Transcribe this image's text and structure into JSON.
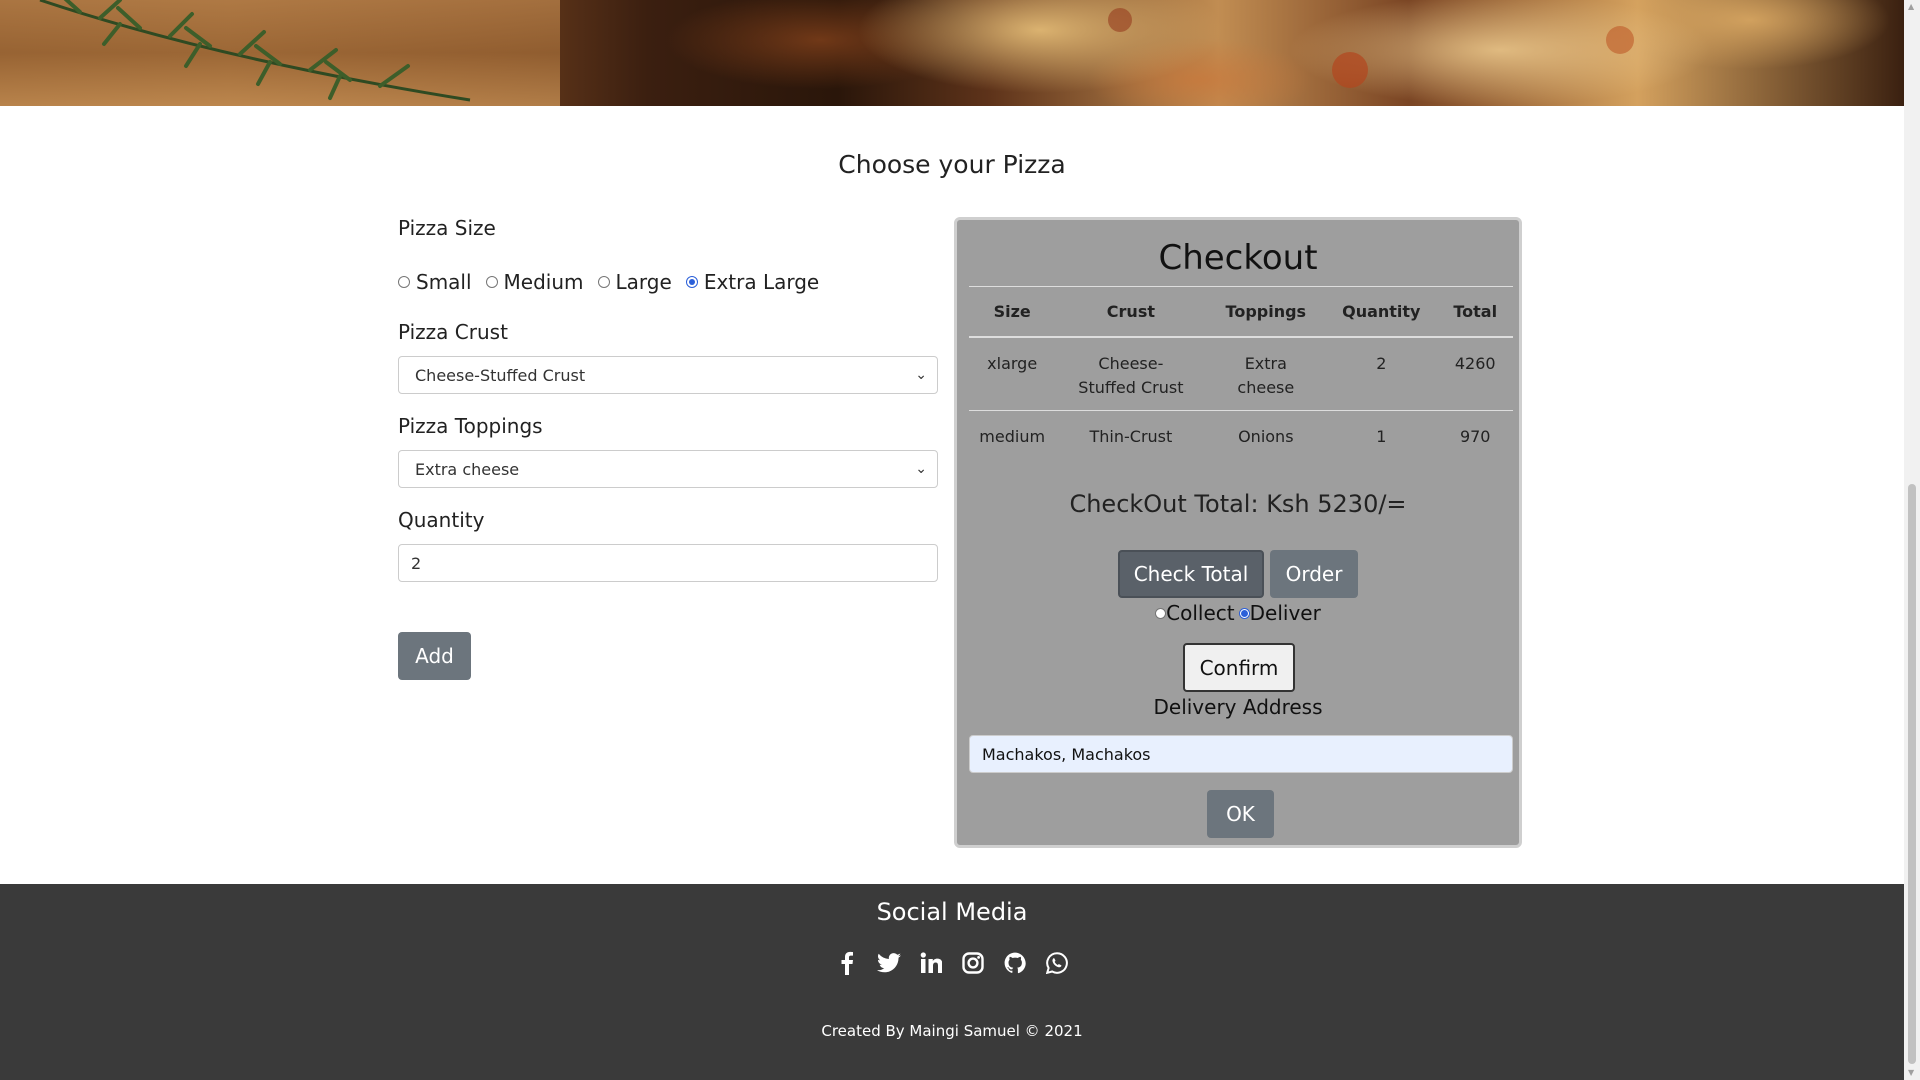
{
  "section_title": "Choose your Pizza",
  "form": {
    "size_label": "Pizza Size",
    "sizes": [
      {
        "label": "Small",
        "checked": false
      },
      {
        "label": "Medium",
        "checked": false
      },
      {
        "label": "Large",
        "checked": false
      },
      {
        "label": "Extra Large",
        "checked": true
      }
    ],
    "crust_label": "Pizza Crust",
    "crust_value": "Cheese-Stuffed Crust",
    "toppings_label": "Pizza Toppings",
    "toppings_value": "Extra cheese",
    "quantity_label": "Quantity",
    "quantity_value": "2",
    "add_button": "Add"
  },
  "checkout": {
    "title": "Checkout",
    "columns": [
      "Size",
      "Crust",
      "Toppings",
      "Quantity",
      "Total"
    ],
    "rows": [
      {
        "size": "xlarge",
        "crust": "Cheese-Stuffed Crust",
        "toppings": "Extra cheese",
        "quantity": "2",
        "total": "4260"
      },
      {
        "size": "medium",
        "crust": "Thin-Crust",
        "toppings": "Onions",
        "quantity": "1",
        "total": "970"
      }
    ],
    "total_text": "CheckOut Total: Ksh 5230/=",
    "check_total_button": "Check Total",
    "order_button": "Order",
    "collect_label": "Collect",
    "deliver_label": "Deliver",
    "delivery_choice": "Deliver",
    "confirm_button": "Confirm",
    "address_label": "Delivery Address",
    "address_value": "Machakos, Machakos",
    "ok_button": "OK"
  },
  "footer": {
    "title": "Social Media",
    "icons": [
      "facebook-icon",
      "twitter-icon",
      "linkedin-icon",
      "instagram-icon",
      "github-icon",
      "whatsapp-icon"
    ],
    "credits": "Created By Maingi Samuel © 2021"
  }
}
